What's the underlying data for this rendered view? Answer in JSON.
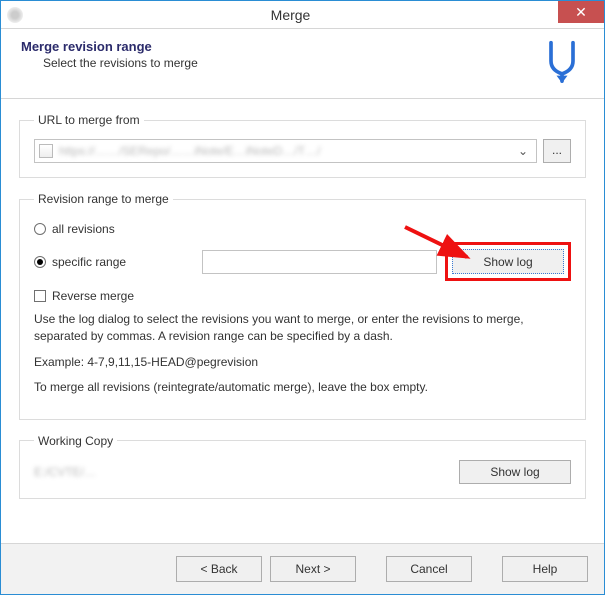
{
  "title": "Merge",
  "header": {
    "title": "Merge revision range",
    "subtitle": "Select the revisions to merge"
  },
  "url_group_label": "URL to merge from",
  "url_value": "https://……/SERepo/……iNote/E…iNoteD…/T…/",
  "browse_label": "...",
  "range_group_label": "Revision range to merge",
  "radio_all_label": "all revisions",
  "radio_specific_label": "specific range",
  "specific_value": "",
  "show_log_label": "Show log",
  "reverse_merge_label": "Reverse merge",
  "help_text1": "Use the log dialog to select the revisions you want to merge, or enter the revisions to merge, separated by commas. A revision range can be specified by a dash.",
  "help_text2": "Example: 4-7,9,11,15-HEAD@pegrevision",
  "help_text3": "To merge all revisions (reintegrate/automatic merge), leave the box empty.",
  "wc_group_label": "Working Copy",
  "wc_path": "E:/CVTE/…",
  "wc_show_log_label": "Show log",
  "footer": {
    "back": "< Back",
    "next": "Next >",
    "cancel": "Cancel",
    "help": "Help"
  }
}
